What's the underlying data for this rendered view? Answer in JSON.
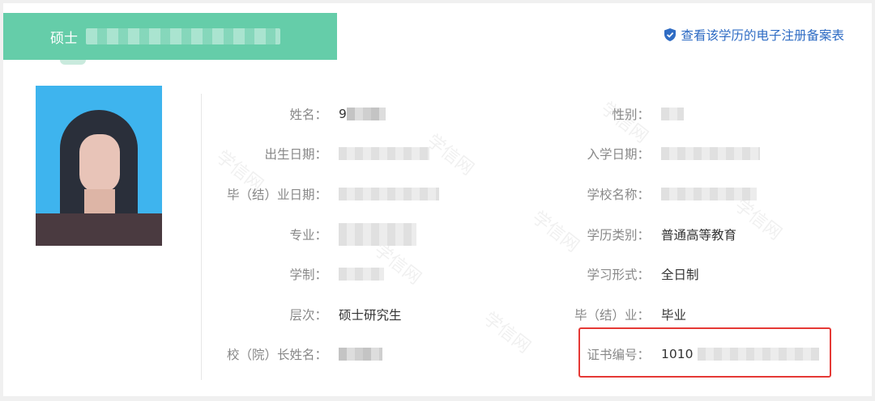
{
  "header": {
    "degree": "硕士",
    "record_link_label": "查看该学历的电子注册备案表",
    "accent_color": "#65cda9",
    "link_color": "#2f6cc4",
    "link_icon": "shield-check-icon"
  },
  "photo": {
    "alt": "student-photo"
  },
  "left_fields": [
    {
      "label": "姓名：",
      "value": "9"
    },
    {
      "label": "出生日期：",
      "value": ""
    },
    {
      "label": "毕（结）业日期：",
      "value": ""
    },
    {
      "label": "专业：",
      "value": ""
    },
    {
      "label": "学制：",
      "value": ""
    },
    {
      "label": "层次：",
      "value": "硕士研究生"
    },
    {
      "label": "校（院）长姓名：",
      "value": ""
    }
  ],
  "right_fields": [
    {
      "label": "性别：",
      "value": ""
    },
    {
      "label": "入学日期：",
      "value": ""
    },
    {
      "label": "学校名称：",
      "value": ""
    },
    {
      "label": "学历类别：",
      "value": "普通高等教育"
    },
    {
      "label": "学习形式：",
      "value": "全日制"
    },
    {
      "label": "毕（结）业：",
      "value": "毕业"
    },
    {
      "label": "证书编号：",
      "value": "1010"
    }
  ],
  "watermark": "学信网",
  "highlight_color": "#e53935"
}
